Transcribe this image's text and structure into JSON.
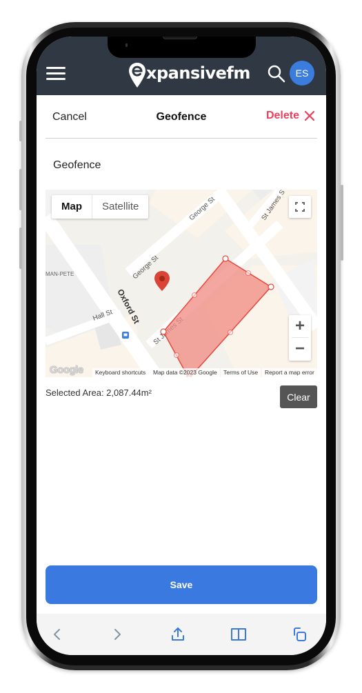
{
  "header": {
    "brand": "xpansivefm",
    "brand_full": "expansivefm",
    "avatar_initials": "ES"
  },
  "titlebar": {
    "cancel_label": "Cancel",
    "title": "Geofence",
    "delete_label": "Delete"
  },
  "form": {
    "name_value": "Geofence"
  },
  "map": {
    "type_options": [
      "Map",
      "Satellite"
    ],
    "type_selected": "Map",
    "street_labels": {
      "george": "George St",
      "george_lower": "George St",
      "st_james": "St James St",
      "st_james_top": "St James S",
      "oxford": "Oxford St",
      "hall": "Hall St",
      "poi": "MAN-PETE"
    },
    "footer": {
      "logo": "Google",
      "keyboard": "Keyboard shortcuts",
      "map_data": "Map data ©2023 Google",
      "terms": "Terms of Use",
      "report": "Report a map error"
    },
    "zoom_in_label": "+",
    "zoom_out_label": "−",
    "polygon_fill": "#f08a80",
    "polygon_stroke": "#e8463c"
  },
  "area": {
    "label": "Selected Area: 2,087.44m²",
    "clear_label": "Clear"
  },
  "actions": {
    "save_label": "Save"
  },
  "colors": {
    "header_bg": "#2f3843",
    "accent_blue": "#3a79df",
    "delete_red": "#ef3e5c"
  },
  "browser_toolbar": {
    "icons": [
      "back-icon",
      "forward-icon",
      "share-icon",
      "bookmarks-icon",
      "tabs-icon"
    ]
  }
}
